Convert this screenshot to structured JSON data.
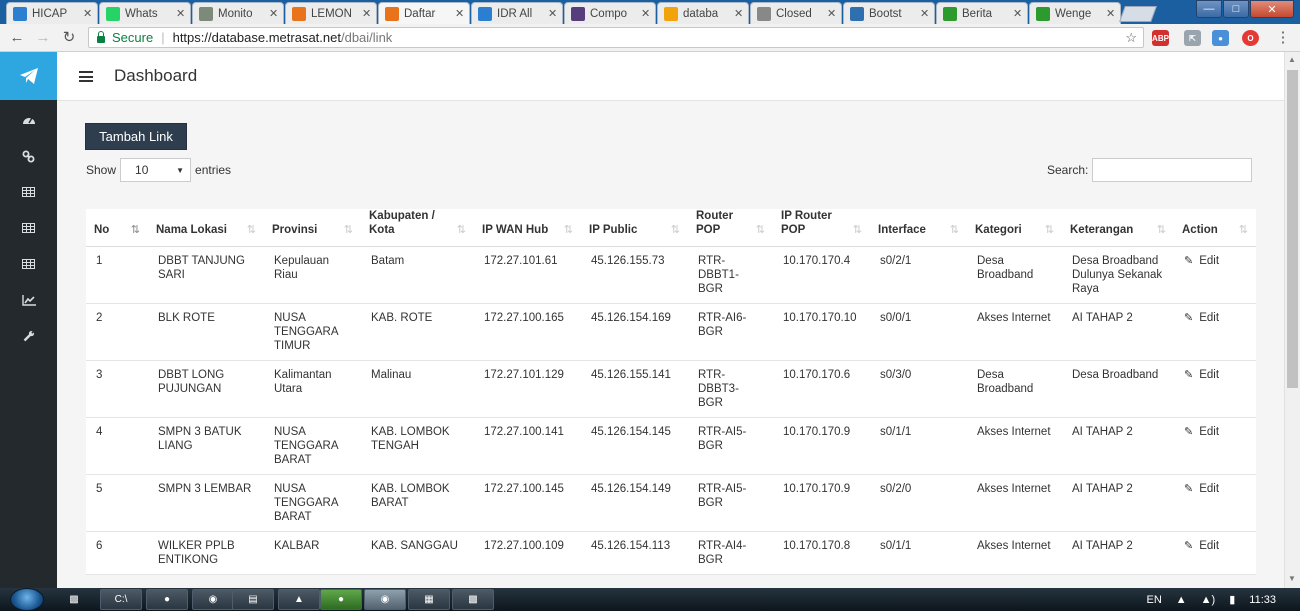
{
  "browser": {
    "tabs": [
      {
        "label": "HICAP",
        "icon": "hicap-icon",
        "color": "#2a7fd0",
        "active": false
      },
      {
        "label": "Whats",
        "icon": "whatsapp-icon",
        "color": "#25d366",
        "active": false
      },
      {
        "label": "Monito",
        "icon": "monitor-icon",
        "color": "#7c8a7a",
        "active": false
      },
      {
        "label": "LEMON",
        "icon": "lemon-icon",
        "color": "#e8731b",
        "active": false
      },
      {
        "label": "Daftar",
        "icon": "daftar-icon",
        "color": "#e8731b",
        "active": true
      },
      {
        "label": "IDR All",
        "icon": "idr-icon",
        "color": "#2a7fd0",
        "active": false
      },
      {
        "label": "Compo",
        "icon": "bootstrap-icon",
        "color": "#563d7c",
        "active": false
      },
      {
        "label": "databa",
        "icon": "pma-icon",
        "color": "#f0a30a",
        "active": false
      },
      {
        "label": "Closed",
        "icon": "closed-icon",
        "color": "#888888",
        "active": false
      },
      {
        "label": "Bootst",
        "icon": "bootsnipp-icon",
        "color": "#2e6fb0",
        "active": false
      },
      {
        "label": "Berita",
        "icon": "berita-icon",
        "color": "#2c9a2c",
        "active": false
      },
      {
        "label": "Wenge",
        "icon": "wenger-icon",
        "color": "#2c9a2c",
        "active": false
      }
    ],
    "secure_label": "Secure",
    "url_main": "https://database.metrasat.net",
    "url_rest": "/dbai/link"
  },
  "header": {
    "title": "Dashboard"
  },
  "toolbar": {
    "add_label": "Tambah Link",
    "show_label": "Show",
    "entries_value": "10",
    "entries_label": "entries",
    "search_label": "Search:",
    "search_value": ""
  },
  "table": {
    "columns": [
      {
        "label": "No",
        "sorted": true
      },
      {
        "label": "Nama Lokasi"
      },
      {
        "label": "Provinsi"
      },
      {
        "label": "Kabupaten / Kota"
      },
      {
        "label": "IP WAN Hub"
      },
      {
        "label": "IP Public"
      },
      {
        "label": "Router POP"
      },
      {
        "label": "IP Router POP"
      },
      {
        "label": "Interface"
      },
      {
        "label": "Kategori"
      },
      {
        "label": "Keterangan"
      },
      {
        "label": "Action"
      }
    ],
    "rows": [
      {
        "no": "1",
        "lokasi": "DBBT TANJUNG SARI",
        "provinsi": "Kepulauan Riau",
        "kota": "Batam",
        "wan": "172.27.101.61",
        "public": "45.126.155.73",
        "router": "RTR-DBBT1-BGR",
        "iprouter": "10.170.170.4",
        "iface": "s0/2/1",
        "kategori": "Desa Broadband",
        "ket": "Desa Broadband Dulunya Sekanak Raya",
        "action": "Edit"
      },
      {
        "no": "2",
        "lokasi": "BLK ROTE",
        "provinsi": "NUSA TENGGARA TIMUR",
        "kota": "KAB. ROTE",
        "wan": "172.27.100.165",
        "public": "45.126.154.169",
        "router": "RTR-AI6-BGR",
        "iprouter": "10.170.170.10",
        "iface": "s0/0/1",
        "kategori": "Akses Internet",
        "ket": "AI TAHAP 2",
        "action": "Edit"
      },
      {
        "no": "3",
        "lokasi": "DBBT LONG PUJUNGAN",
        "provinsi": "Kalimantan Utara",
        "kota": "Malinau",
        "wan": "172.27.101.129",
        "public": "45.126.155.141",
        "router": "RTR-DBBT3-BGR",
        "iprouter": "10.170.170.6",
        "iface": "s0/3/0",
        "kategori": "Desa Broadband",
        "ket": "Desa Broadband",
        "action": "Edit"
      },
      {
        "no": "4",
        "lokasi": "SMPN 3 BATUK LIANG",
        "provinsi": "NUSA TENGGARA BARAT",
        "kota": "KAB. LOMBOK TENGAH",
        "wan": "172.27.100.141",
        "public": "45.126.154.145",
        "router": "RTR-AI5-BGR",
        "iprouter": "10.170.170.9",
        "iface": "s0/1/1",
        "kategori": "Akses Internet",
        "ket": "AI TAHAP 2",
        "action": "Edit"
      },
      {
        "no": "5",
        "lokasi": "SMPN 3 LEMBAR",
        "provinsi": "NUSA TENGGARA BARAT",
        "kota": "KAB. LOMBOK BARAT",
        "wan": "172.27.100.145",
        "public": "45.126.154.149",
        "router": "RTR-AI5-BGR",
        "iprouter": "10.170.170.9",
        "iface": "s0/2/0",
        "kategori": "Akses Internet",
        "ket": "AI TAHAP 2",
        "action": "Edit"
      },
      {
        "no": "6",
        "lokasi": "WILKER PPLB ENTIKONG",
        "provinsi": "KALBAR",
        "kota": "KAB. SANGGAU",
        "wan": "172.27.100.109",
        "public": "45.126.154.113",
        "router": "RTR-AI4-BGR",
        "iprouter": "10.170.170.8",
        "iface": "s0/1/1",
        "kategori": "Akses Internet",
        "ket": "AI TAHAP 2",
        "action": "Edit"
      }
    ]
  },
  "taskbar": {
    "lang": "EN",
    "clock": "11:33"
  }
}
